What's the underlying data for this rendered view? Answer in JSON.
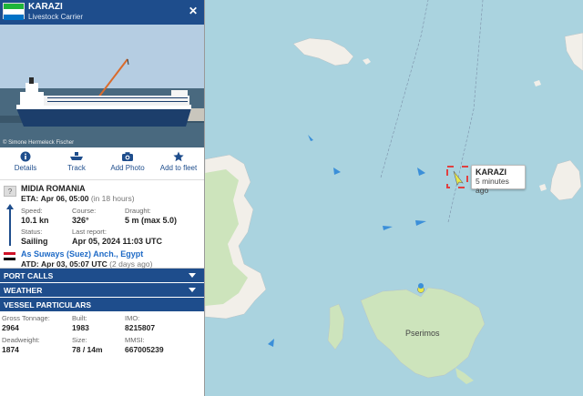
{
  "vessel": {
    "name": "KARAZI",
    "type": "Livestock Carrier",
    "photo_credit": "© Simone Hermeleck Fischer"
  },
  "actions": [
    {
      "label": "Details",
      "icon": "info-icon"
    },
    {
      "label": "Track",
      "icon": "ship-icon"
    },
    {
      "label": "Add Photo",
      "icon": "camera-icon"
    },
    {
      "label": "Add to fleet",
      "icon": "star-icon"
    }
  ],
  "destination": {
    "unknown_badge": "?",
    "name": "MIDIA ROMANIA",
    "eta_label": "ETA:",
    "eta": "Apr 06, 05:00",
    "eta_rel": "(in 18 hours)"
  },
  "voyage": {
    "speed_label": "Speed:",
    "speed": "10.1 kn",
    "course_label": "Course:",
    "course": "326°",
    "draught_label": "Draught:",
    "draught": "5 m (max 5.0)",
    "status_label": "Status:",
    "status": "Sailing",
    "report_label": "Last report:",
    "report": "Apr 05, 2024 11:03 UTC"
  },
  "origin": {
    "port": "As Suways (Suez) Anch., Egypt",
    "atd_label": "ATD:",
    "atd": "Apr 03, 05:07 UTC",
    "atd_rel": "(2 days ago)"
  },
  "sections": {
    "port_calls": "PORT CALLS",
    "weather": "WEATHER",
    "particulars": "VESSEL PARTICULARS"
  },
  "particulars": {
    "gt_label": "Gross Tonnage:",
    "gt": "2964",
    "built_label": "Built:",
    "built": "1983",
    "imo_label": "IMO:",
    "imo": "8215807",
    "dwt_label": "Deadweight:",
    "dwt": "1874",
    "size_label": "Size:",
    "size": "78 / 14m",
    "mmsi_label": "MMSI:",
    "mmsi": "667005239"
  },
  "map": {
    "tooltip_name": "KARAZI",
    "tooltip_time": "5 minutes ago",
    "place": "Pserimos"
  },
  "colors": {
    "header": "#1e4d8c",
    "sea": "#aad3df",
    "land": "#f2efe9",
    "vegetation": "#cde4bc",
    "selected_vessel": "#e8e84a",
    "selection_box": "#e04040"
  }
}
